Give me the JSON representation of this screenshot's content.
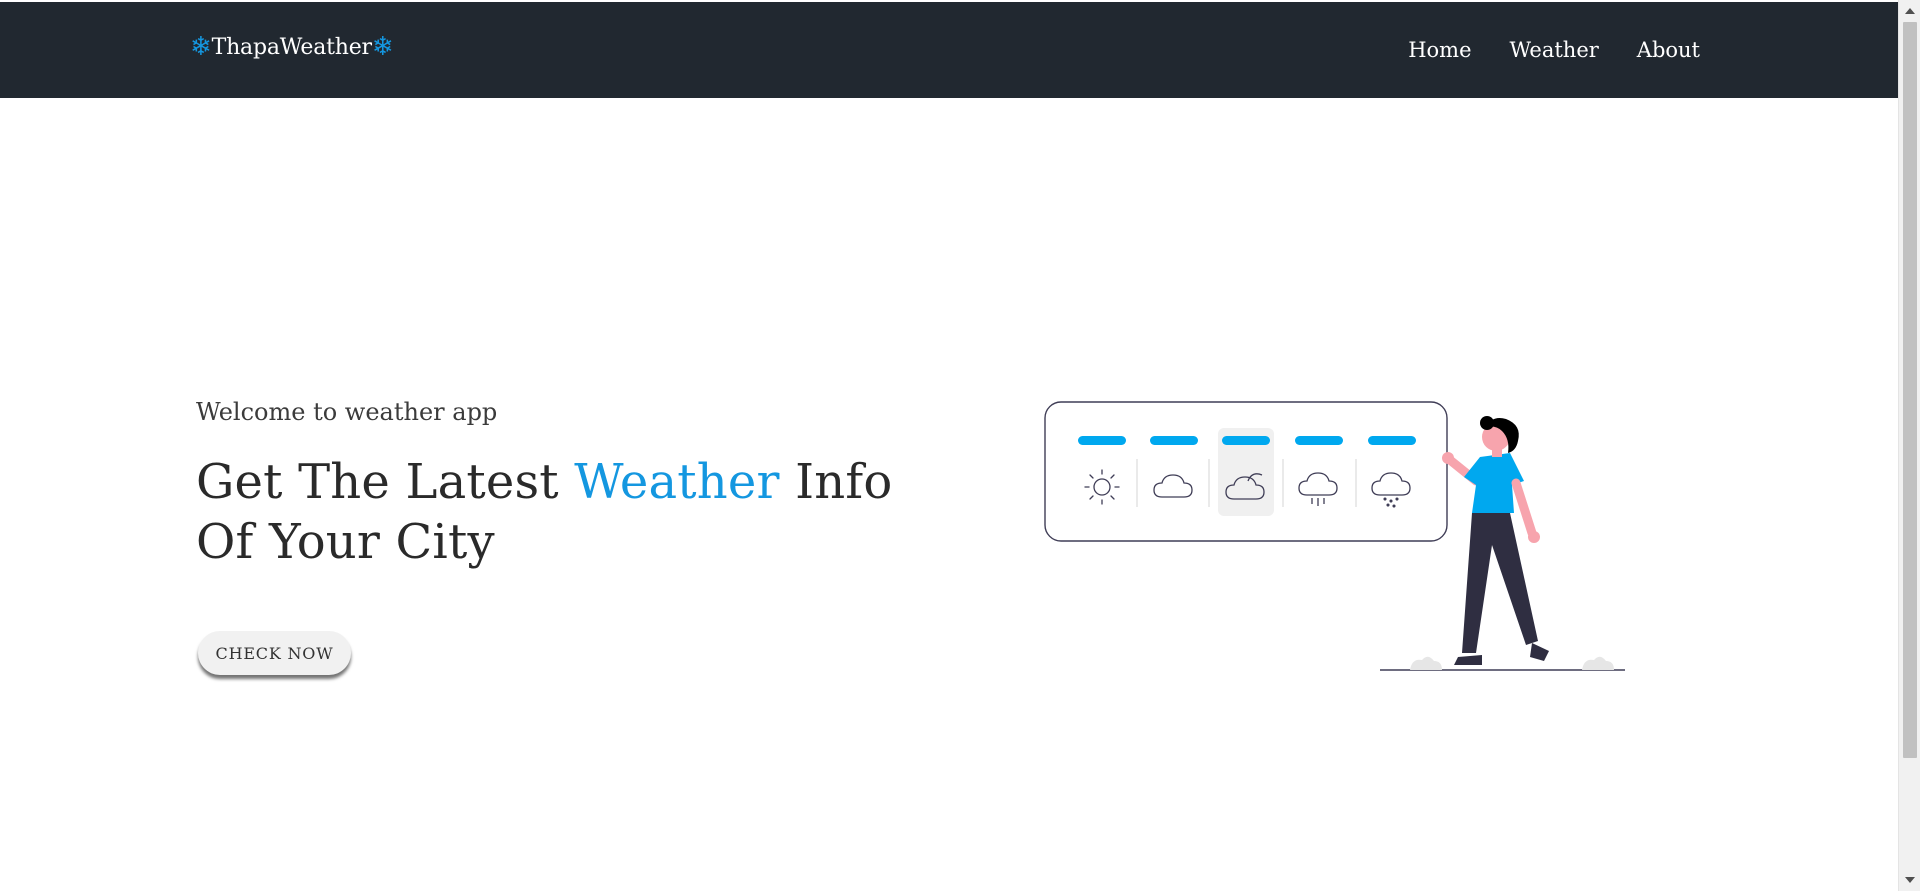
{
  "navbar": {
    "brand_text": "ThapaWeather",
    "brand_icon": "snowflake-icon",
    "brand_icon_glyph": "❄",
    "links": [
      {
        "label": "Home"
      },
      {
        "label": "Weather"
      },
      {
        "label": "About"
      }
    ]
  },
  "hero": {
    "welcome": "Welcome to weather app",
    "headline_before": "Get The Latest ",
    "headline_accent": "Weather",
    "headline_after": " Info Of Your City",
    "cta_label": "CHECK NOW"
  },
  "illustration": {
    "weather_icons": [
      "sun-icon",
      "cloud-icon",
      "partly-cloudy-icon",
      "rain-icon",
      "snow-icon"
    ]
  },
  "colors": {
    "navbar_bg": "#212830",
    "accent": "#1497e0",
    "indicator": "#00a8ef",
    "figure_shirt": "#00a8ef",
    "figure_pants": "#2f2e41",
    "skin": "#f7a4ad"
  }
}
